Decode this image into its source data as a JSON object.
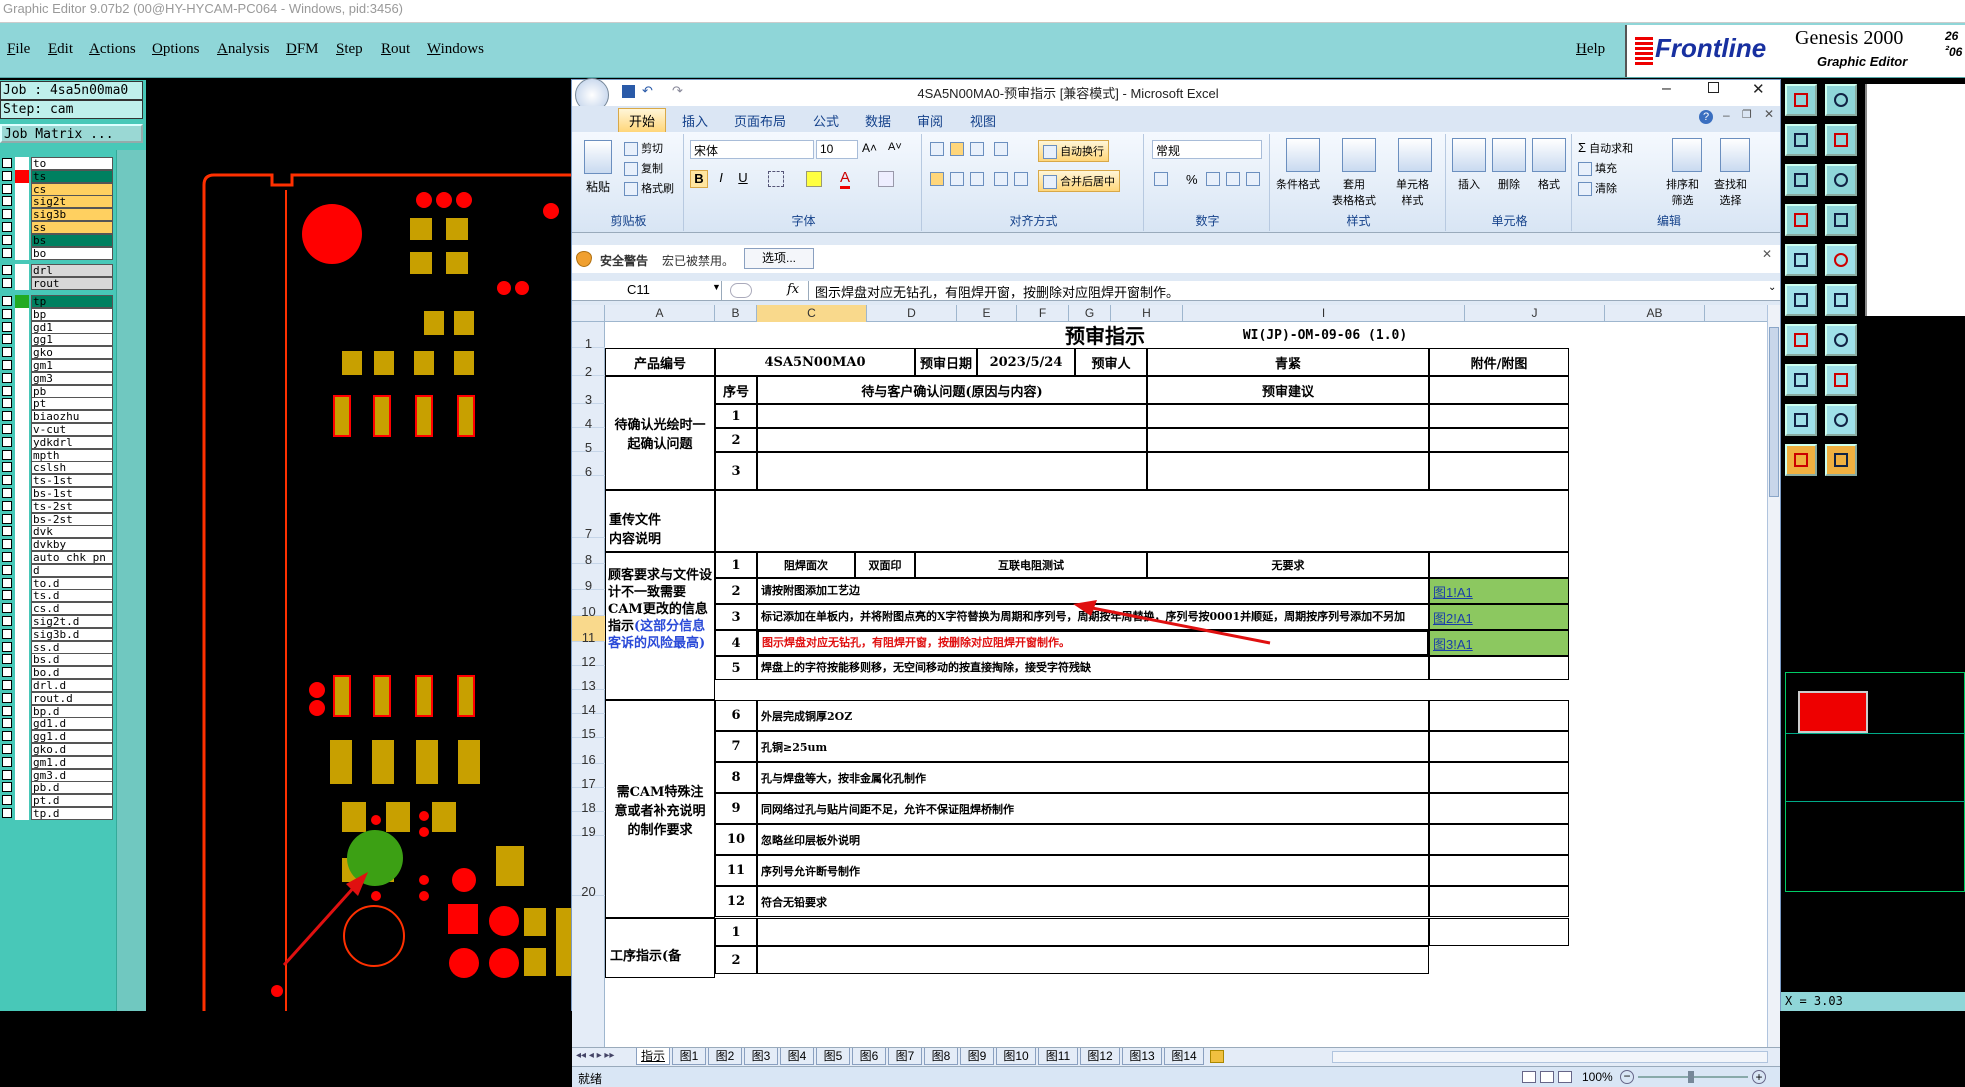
{
  "app": {
    "title": "Graphic Editor 9.07b2 (00@HY-HYCAM-PC064 - Windows, pid:3456)",
    "menu": [
      "File",
      "Edit",
      "Actions",
      "Options",
      "Analysis",
      "DFM",
      "Step",
      "Rout",
      "Windows"
    ],
    "help": "Help",
    "logo_brand": "Frontline",
    "logo_product": "Genesis 2000",
    "logo_sub": "Graphic Editor",
    "logo_edge1": "26 ²",
    "logo_edge2": "06"
  },
  "sidebar": {
    "job": "Job : 4sa5n00ma0",
    "step": "Step: cam",
    "matrix_button": "Job Matrix ...",
    "layers": [
      {
        "name": "to",
        "color": "#ffffff"
      },
      {
        "name": "ts",
        "color": "#008060",
        "swatch": "#ff0000"
      },
      {
        "name": "cs",
        "color": "#ffd060"
      },
      {
        "name": "sig2t",
        "color": "#ffd060"
      },
      {
        "name": "sig3b",
        "color": "#ffd060"
      },
      {
        "name": "ss",
        "color": "#ffd060"
      },
      {
        "name": "bs",
        "color": "#008060"
      },
      {
        "name": "bo",
        "color": "#ffffff"
      },
      {
        "name": "drl",
        "color": "#d8d8d8"
      },
      {
        "name": "rout",
        "color": "#d8d8d8"
      },
      {
        "name": "tp",
        "color": "#008060",
        "swatch": "#22aa22"
      },
      {
        "name": "bp"
      },
      {
        "name": "gd1"
      },
      {
        "name": "gg1"
      },
      {
        "name": "gko"
      },
      {
        "name": "gm1"
      },
      {
        "name": "gm3"
      },
      {
        "name": "pb"
      },
      {
        "name": "pt"
      },
      {
        "name": "biaozhu"
      },
      {
        "name": "v-cut"
      },
      {
        "name": "ydkdrl"
      },
      {
        "name": "mpth"
      },
      {
        "name": "cslsh"
      },
      {
        "name": "ts-1st"
      },
      {
        "name": "bs-1st"
      },
      {
        "name": "ts-2st"
      },
      {
        "name": "bs-2st"
      },
      {
        "name": "dvk"
      },
      {
        "name": "dvkby"
      },
      {
        "name": "auto_chk_pn"
      },
      {
        "name": "d"
      },
      {
        "name": "to.d"
      },
      {
        "name": "ts.d"
      },
      {
        "name": "cs.d"
      },
      {
        "name": "sig2t.d"
      },
      {
        "name": "sig3b.d"
      },
      {
        "name": "ss.d"
      },
      {
        "name": "bs.d"
      },
      {
        "name": "bo.d"
      },
      {
        "name": "drl.d"
      },
      {
        "name": "rout.d"
      },
      {
        "name": "bp.d"
      },
      {
        "name": "gd1.d"
      },
      {
        "name": "gg1.d"
      },
      {
        "name": "gko.d"
      },
      {
        "name": "gm1.d"
      },
      {
        "name": "gm3.d"
      },
      {
        "name": "pb.d"
      },
      {
        "name": "pt.d"
      },
      {
        "name": "tp.d"
      }
    ]
  },
  "excel": {
    "title": "4SA5N00MA0-预审指示 [兼容模式] - Microsoft Excel",
    "tabs": [
      "开始",
      "插入",
      "页面布局",
      "公式",
      "数据",
      "审阅",
      "视图"
    ],
    "clipboard": {
      "paste": "粘贴",
      "cut": "剪切",
      "copy": "复制",
      "painter": "格式刷",
      "label": "剪贴板"
    },
    "font": {
      "name": "宋体",
      "size": "10",
      "label": "字体",
      "bold": "B",
      "italic": "I",
      "underline": "U",
      "a_up": "A˄",
      "a_down": "A˅",
      "fill_a": "A"
    },
    "align": {
      "wrap": "自动换行",
      "merge": "合并后居中",
      "label": "对齐方式"
    },
    "number": {
      "format": "常规",
      "percent": "%",
      "label": "数字"
    },
    "styles": {
      "cond": "条件格式",
      "table": "套用\n表格格式",
      "cell": "单元格\n样式",
      "label": "样式"
    },
    "cells": {
      "insert": "插入",
      "delete": "删除",
      "format": "格式",
      "label": "单元格"
    },
    "edit": {
      "sum": "自动求和",
      "fill": "填充",
      "clear": "清除",
      "sort": "排序和\n筛选",
      "find": "查找和\n选择",
      "label": "编辑"
    },
    "security": {
      "title": "安全警告",
      "text": "宏已被禁用。",
      "button": "选项..."
    },
    "namebox": "C11",
    "fx": "fx",
    "formula": "图示焊盘对应无钻孔，有阻焊开窗，按删除对应阻焊开窗制作。",
    "columns": [
      "A",
      "B",
      "C",
      "D",
      "E",
      "F",
      "G",
      "H",
      "I",
      "J",
      "AB"
    ],
    "rows": [
      "1",
      "2",
      "3",
      "4",
      "5",
      "6",
      "7",
      "8",
      "9",
      "10",
      "11",
      "12",
      "13",
      "14",
      "15",
      "16",
      "17",
      "18",
      "19",
      "20"
    ],
    "sheet": {
      "title": "预审指示",
      "doc_no": "WI(JP)-OM-09-06 (1.0)",
      "r2": {
        "a": "产品编号",
        "bc": "4SA5N00MA0",
        "e": "预审日期",
        "fg": "2023/5/24",
        "h": "预审人",
        "i": "青紧",
        "j": "附件/附图"
      },
      "r3": {
        "b": "序号",
        "c": "待与客户确认问题(原因与内容)",
        "i": "预审建议"
      },
      "sec1": "待确认光绘时一起确认问题",
      "nums1": [
        "1",
        "2",
        "3"
      ],
      "sec2": "重传文件\n内容说明",
      "r8": {
        "num": "1",
        "c": "阻焊面次",
        "d": "双面印",
        "e": "互联电阻测试",
        "i": "无要求"
      },
      "sec3a": "顾客要求与文件设计不一致需要CAM更改的信息指示",
      "sec3b": "(这部分信息客诉的风险最高)",
      "r9": {
        "num": "2",
        "text": "请按附图添加工艺边",
        "link": "图1!A1"
      },
      "r10": {
        "num": "3",
        "text": "标记添加在单板内，并将附图点亮的X字符替换为周期和序列号，周期按年周替换，序列号按0001并顺延，周期按序列号添加不另加",
        "link": "图2!A1"
      },
      "r11": {
        "num": "4",
        "text": "图示焊盘对应无钻孔，有阻焊开窗，按删除对应阻焊开窗制作。",
        "link": "图3!A1"
      },
      "r12": {
        "num": "5",
        "text": "焊盘上的字符按能移则移，无空间移动的按直接掏除，接受字符残缺"
      },
      "sec4": "需CAM特殊注意或者补充说明的制作要求",
      "special": [
        {
          "num": "6",
          "text": "外层完成铜厚2OZ"
        },
        {
          "num": "7",
          "text": "孔铜≥25um"
        },
        {
          "num": "8",
          "text": "孔与焊盘等大，按非金属化孔制作"
        },
        {
          "num": "9",
          "text": "同网络过孔与贴片间距不足，允许不保证阻焊桥制作"
        },
        {
          "num": "10",
          "text": "忽略丝印层板外说明"
        },
        {
          "num": "11",
          "text": "序列号允许断号制作"
        },
        {
          "num": "12",
          "text": "符合无铅要求"
        }
      ],
      "sec5": "工序指示(备",
      "r20": {
        "num1": "1",
        "num2": "2"
      }
    },
    "sheet_tabs": [
      "指示",
      "图1",
      "图2",
      "图3",
      "图4",
      "图5",
      "图6",
      "图7",
      "图8",
      "图9",
      "图10",
      "图11",
      "图12",
      "图13",
      "图14"
    ],
    "status": "就绪",
    "zoom": "100%",
    "accent": "#f0a030",
    "link_fill": "#8cc860"
  },
  "right": {
    "readout": "X = 3.03"
  }
}
